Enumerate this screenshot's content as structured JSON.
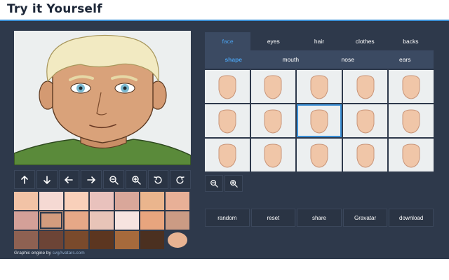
{
  "page_title": "Try it Yourself",
  "colors": {
    "accent": "#3a8fd6",
    "panel_bg": "#2e394b",
    "active_tab_text": "#4a9ee8"
  },
  "toolbar": {
    "icons": [
      "arrow-up-icon",
      "arrow-down-icon",
      "arrow-left-icon",
      "arrow-right-icon",
      "zoom-out-icon",
      "zoom-in-icon",
      "rotate-left-icon",
      "rotate-right-icon"
    ]
  },
  "skin_swatches": {
    "rows": [
      [
        "#f2c3a6",
        "#f5d9d3",
        "#f9d0ba",
        "#e9c2bd",
        "#d9a79a",
        "#eab58d",
        "#e8b097"
      ],
      [
        "#d4a098",
        "#d39c7e",
        "#e6a887",
        "#e8c4b8",
        "#f7e4e0",
        "#e8a57e",
        "#cb9b84"
      ],
      [
        "#8e6152",
        "#6c4436",
        "#7a4a2c",
        "#5c3620",
        "#a66a3c",
        "#4b3020"
      ]
    ],
    "selected_row": 1,
    "selected_col": 1,
    "current_color": "#e8b392"
  },
  "credit": {
    "prefix": "Graphic engine by ",
    "link": "svgAvatars.com"
  },
  "tabs": [
    {
      "label": "face",
      "active": true
    },
    {
      "label": "eyes",
      "active": false
    },
    {
      "label": "hair",
      "active": false
    },
    {
      "label": "clothes",
      "active": false
    },
    {
      "label": "backs",
      "active": false
    }
  ],
  "subtabs": [
    {
      "label": "shape",
      "active": true
    },
    {
      "label": "mouth",
      "active": false
    },
    {
      "label": "nose",
      "active": false
    },
    {
      "label": "ears",
      "active": false
    }
  ],
  "shape_options": {
    "count": 15,
    "selected_index": 7,
    "fill": "#f0c6a8",
    "stroke": "#c9967a"
  },
  "zoom_icons": [
    "zoom-out-icon",
    "zoom-in-icon"
  ],
  "actions": [
    {
      "label": "random"
    },
    {
      "label": "reset"
    },
    {
      "label": "share"
    },
    {
      "label": "Gravatar"
    },
    {
      "label": "download"
    }
  ]
}
